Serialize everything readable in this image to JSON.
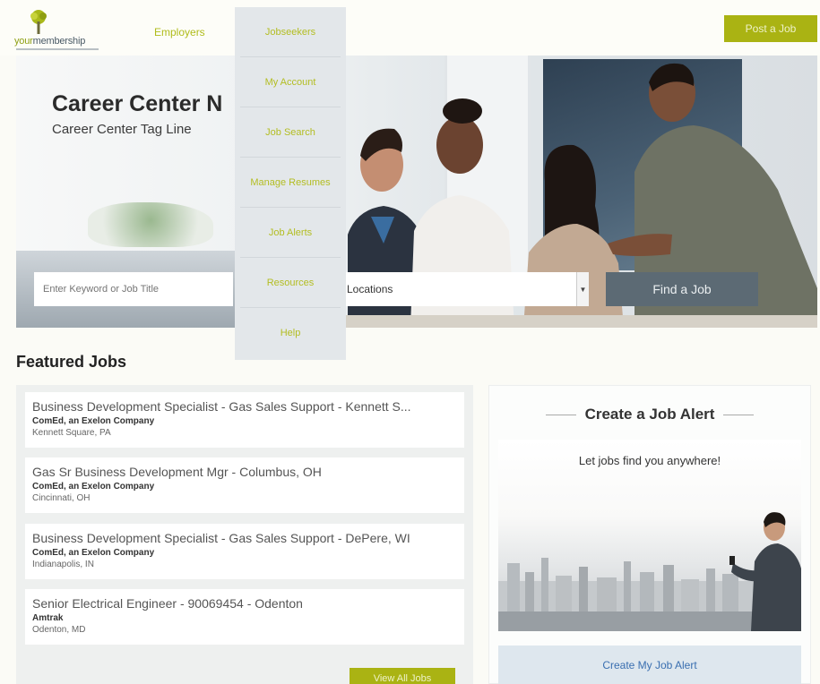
{
  "header": {
    "logo_your": "your",
    "logo_membership": "membership",
    "nav_employers": "Employers",
    "post_job_label": "Post a Job"
  },
  "dropdown": {
    "items": [
      "Jobseekers",
      "My Account",
      "Job Search",
      "Manage Resumes",
      "Job Alerts",
      "Resources",
      "Help"
    ]
  },
  "hero": {
    "title": "Career Center N",
    "tagline": "Career Center Tag Line",
    "keyword_placeholder": "Enter Keyword or Job Title",
    "locations_label": "Locations",
    "find_job_label": "Find a Job"
  },
  "featured": {
    "title": "Featured Jobs",
    "jobs": [
      {
        "title": "Business Development Specialist - Gas Sales Support - Kennett S...",
        "company": "ComEd, an Exelon Company",
        "location": "Kennett Square, PA"
      },
      {
        "title": "Gas Sr Business Development Mgr - Columbus, OH",
        "company": "ComEd, an Exelon Company",
        "location": "Cincinnati, OH"
      },
      {
        "title": "Business Development Specialist - Gas Sales Support - DePere, WI",
        "company": "ComEd, an Exelon Company",
        "location": "Indianapolis, IN"
      },
      {
        "title": "Senior Electrical Engineer - 90069454 - Odenton",
        "company": "Amtrak",
        "location": "Odenton, MD"
      }
    ],
    "view_all_label": "View All Jobs"
  },
  "alert": {
    "title": "Create a Job Alert",
    "subtitle": "Let jobs find you anywhere!",
    "button_label": "Create My Job Alert"
  },
  "colors": {
    "accent": "#aab313",
    "nav_text": "#b0bc1a",
    "find_button": "#5c6a74",
    "alert_link": "#3a6fb0"
  }
}
